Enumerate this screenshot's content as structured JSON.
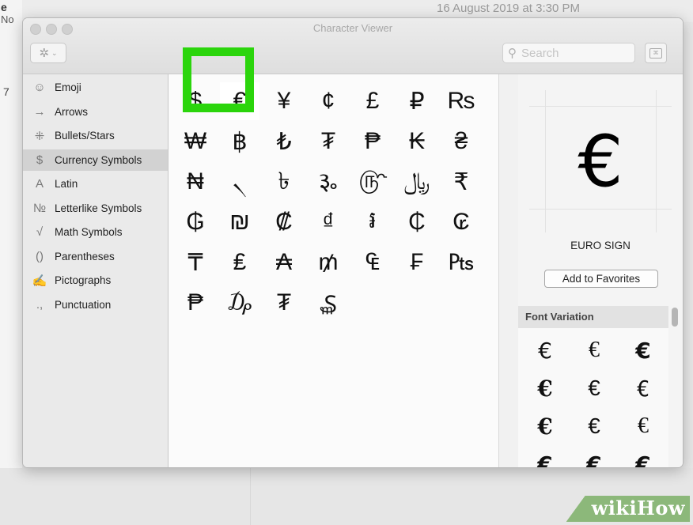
{
  "background": {
    "date_text": "16 August 2019 at 3:30 PM",
    "letter_e": "e",
    "letters_no": "No",
    "number_7": "7"
  },
  "window": {
    "title": "Character Viewer"
  },
  "toolbar": {
    "gear_icon": "gear-icon",
    "search_placeholder": "Search"
  },
  "sidebar": {
    "items": [
      {
        "icon": "☺",
        "label": "Emoji",
        "selected": false
      },
      {
        "icon": "→",
        "label": "Arrows",
        "selected": false
      },
      {
        "icon": "⁜",
        "label": "Bullets/Stars",
        "selected": false
      },
      {
        "icon": "$",
        "label": "Currency Symbols",
        "selected": true
      },
      {
        "icon": "A",
        "label": "Latin",
        "selected": false
      },
      {
        "icon": "№",
        "label": "Letterlike Symbols",
        "selected": false
      },
      {
        "icon": "√",
        "label": "Math Symbols",
        "selected": false
      },
      {
        "icon": "()",
        "label": "Parentheses",
        "selected": false
      },
      {
        "icon": "✍",
        "label": "Pictographs",
        "selected": false
      },
      {
        "icon": ".,",
        "label": "Punctuation",
        "selected": false
      }
    ]
  },
  "characters": [
    [
      "$",
      "€",
      "¥",
      "¢",
      "£",
      "₽",
      "₨"
    ],
    [
      "₩",
      "฿",
      "₺",
      "₮",
      "₱",
      "₭",
      "₴"
    ],
    [
      "₦",
      "৲",
      "৳",
      "૱",
      "௹",
      "﷼",
      "₹"
    ],
    [
      "₲",
      "₪",
      "₡",
      "₫",
      "៛",
      "₵",
      "₢"
    ],
    [
      "₸",
      "₤",
      "₳",
      "₥",
      "₠",
      "₣",
      "₧"
    ],
    [
      "₱",
      "₯",
      "₮",
      "₷"
    ]
  ],
  "selected_char": "€",
  "detail": {
    "glyph": "€",
    "name": "EURO SIGN",
    "favorites_button": "Add to Favorites",
    "font_variation_header": "Font Variation",
    "variations": [
      "€",
      "€",
      "€",
      "€",
      "€",
      "€",
      "€",
      "€",
      "€",
      "€",
      "€",
      "€"
    ]
  },
  "watermark": "wikiHow",
  "accent_color": "#2bd50c"
}
